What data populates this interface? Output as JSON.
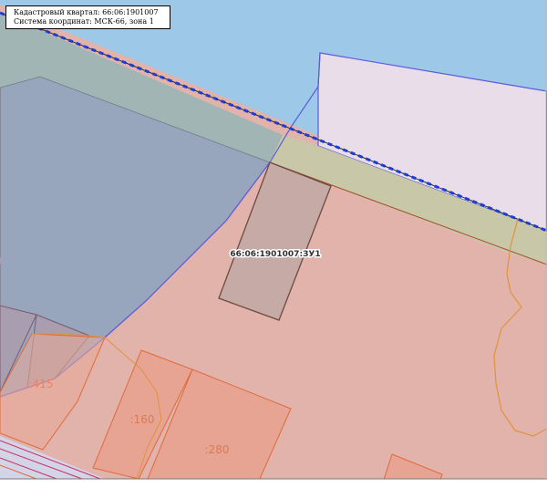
{
  "legend": {
    "quarter_line": "Кадастровый квартал: 66:06:1901007",
    "coords_line": "Система координат: МСК-66, зона 1"
  },
  "labels": {
    "target_parcel": "66:06:1901007:ЗУ1",
    "parcel_415": ":415",
    "parcel_160": ":160",
    "parcel_280": ":280"
  },
  "colors": {
    "water": "#9dc8e8",
    "land": "#e2b3ab",
    "target_parcel_outline": "#6b4b40",
    "quarter_boundary": "#1a3ee0",
    "protected_zone": "#5b5bdc",
    "parcel_edge": "#e06a3a",
    "contour_line": "#e3923a"
  }
}
